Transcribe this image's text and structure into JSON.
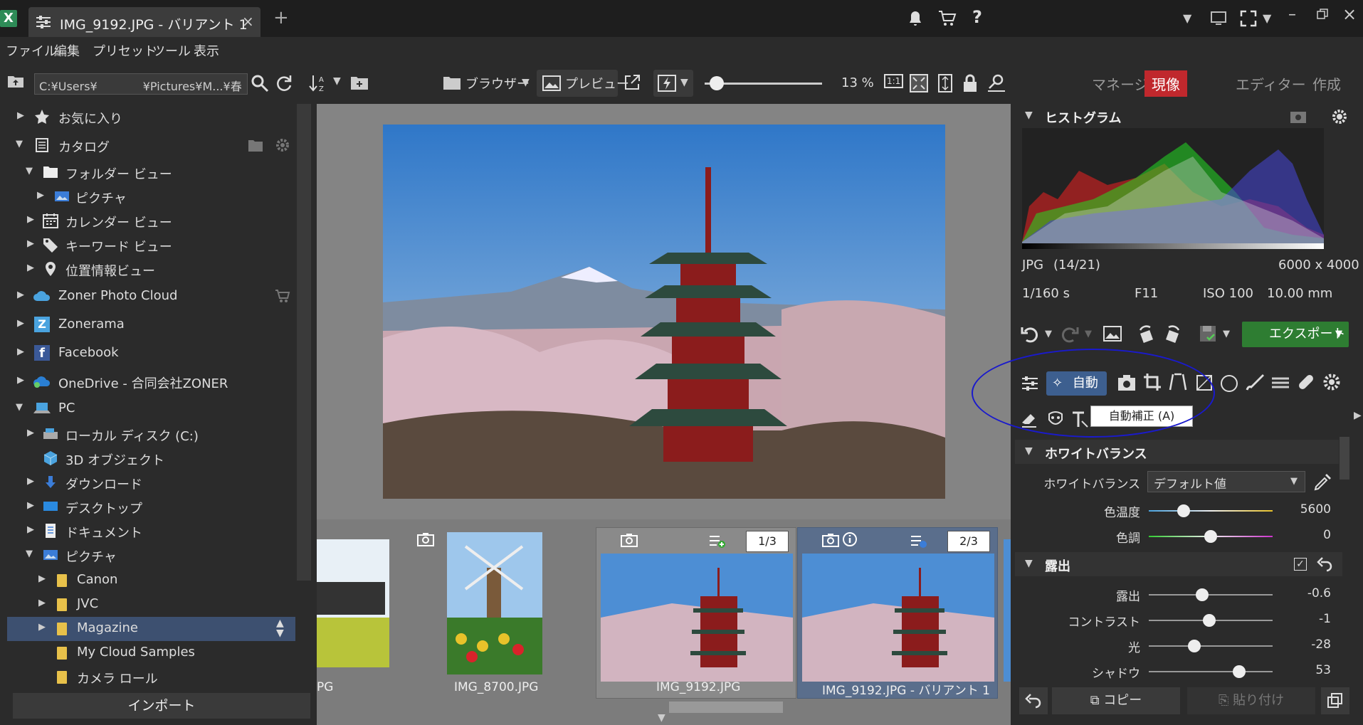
{
  "window": {
    "tab_title": "IMG_9192.JPG - バリアント 1",
    "close_glyph": "×",
    "new_tab_glyph": "+"
  },
  "menu": [
    "ファイル",
    "編集",
    "プリセット",
    "ツール",
    "表示"
  ],
  "toolbar": {
    "path": "C:¥Users¥　　　　¥Pictures¥M...¥春",
    "browser_label": "ブラウザー",
    "preview_label": "プレビュー",
    "zoom_value": "13 %",
    "zoom_level": 0.1,
    "zoom_1to1": "1:1",
    "modes": [
      "マネージャー",
      "現像",
      "エディター",
      "作成"
    ]
  },
  "sidebar": {
    "favorites": "お気に入り",
    "catalog": "カタログ",
    "folder_view": "フォルダー ビュー",
    "pictures": "ピクチャ",
    "calendar_view": "カレンダー ビュー",
    "keyword_view": "キーワード ビュー",
    "location_view": "位置情報ビュー",
    "zoner_cloud": "Zoner Photo Cloud",
    "zonerama": "Zonerama",
    "facebook": "Facebook",
    "onedrive": "OneDrive - 合同会社ZONER",
    "pc": "PC",
    "local_disk": "ローカル ディスク (C:)",
    "objects3d": "3D オブジェクト",
    "downloads": "ダウンロード",
    "desktop": "デスクトップ",
    "documents": "ドキュメント",
    "pictures2": "ピクチャ",
    "canon": "Canon",
    "jvc": "JVC",
    "magazine": "Magazine",
    "cloud_samples": "My Cloud Samples",
    "camera_roll": "カメラ ロール",
    "import": "インポート"
  },
  "filmstrip": {
    "items": [
      {
        "name": "PG"
      },
      {
        "name": "IMG_8700.JPG"
      },
      {
        "name": "IMG_9192.JPG",
        "badge": "1/3"
      },
      {
        "name": "IMG_9192.JPG - バリアント 1",
        "badge": "2/3"
      }
    ]
  },
  "right": {
    "histogram_title": "ヒストグラム",
    "format": "JPG",
    "index": "(14/21)",
    "dimensions": "6000 x 4000",
    "shutter": "1/160 s",
    "aperture": "F11",
    "iso": "ISO 100",
    "focal": "10.00 mm",
    "export_label": "エクスポート",
    "auto_label": "自動",
    "tooltip": "自動補正 (A)",
    "wb_section": "ホワイトバランス",
    "wb_label": "ホワイトバランス",
    "wb_value": "デフォルト値",
    "exposure_section": "露出",
    "copy_label": "コピー",
    "paste_label": "貼り付け",
    "sliders_wb": [
      {
        "label": "色温度",
        "value": "5600",
        "pos": 0.28
      },
      {
        "label": "色調",
        "value": "0",
        "pos": 0.5
      }
    ],
    "sliders_exp": [
      {
        "label": "露出",
        "value": "-0.6",
        "pos": 0.43
      },
      {
        "label": "コントラスト",
        "value": "-1",
        "pos": 0.49
      },
      {
        "label": "光",
        "value": "-28",
        "pos": 0.37
      },
      {
        "label": "シャドウ",
        "value": "53",
        "pos": 0.73
      }
    ]
  },
  "colors": {
    "accent_develop": "#c0282d",
    "export_green": "#2e7d32",
    "highlight_blue": "#1a1acc"
  }
}
